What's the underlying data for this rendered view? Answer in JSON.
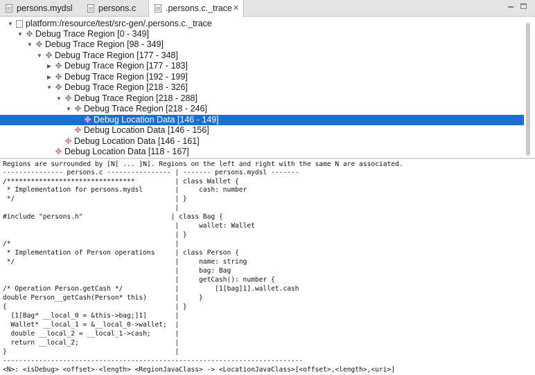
{
  "tabs": [
    {
      "label": "persons.mydsl"
    },
    {
      "label": "persons.c"
    },
    {
      "label": ".persons.c._trace"
    }
  ],
  "window_controls": {
    "minimize": "minimize-icon",
    "maximize": "maximize-icon"
  },
  "tree": {
    "rows": [
      {
        "label": "platform:/resource/test/src-gen/.persons.c._trace",
        "expanded": true,
        "kind": "root"
      },
      {
        "label": "Debug Trace Region [0 - 349]",
        "expanded": true,
        "kind": "region"
      },
      {
        "label": "Debug Trace Region [98 - 349]",
        "expanded": true,
        "kind": "region"
      },
      {
        "label": "Debug Trace Region [177 - 348]",
        "expanded": true,
        "kind": "region"
      },
      {
        "label": "Debug Trace Region [177 - 183]",
        "expanded": false,
        "kind": "region"
      },
      {
        "label": "Debug Trace Region [192 - 199]",
        "expanded": false,
        "kind": "region"
      },
      {
        "label": "Debug Trace Region [218 - 326]",
        "expanded": true,
        "kind": "region"
      },
      {
        "label": "Debug Trace Region [218 - 288]",
        "expanded": true,
        "kind": "region"
      },
      {
        "label": "Debug Trace Region [218 - 246]",
        "expanded": true,
        "kind": "region"
      },
      {
        "label": "Debug Location Data [146 - 149]",
        "kind": "location",
        "selected": true
      },
      {
        "label": "Debug Location Data [146 - 156]",
        "kind": "location"
      },
      {
        "label": "Debug Location Data [146 - 161]",
        "kind": "location"
      },
      {
        "label": "Debug Location Data [118 - 167]",
        "kind": "location"
      }
    ]
  },
  "text_pane": {
    "lines": [
      "Regions are surrounded by [N[ ... ]N]. Regions on the left and right with the same N are associated.",
      "--------------- persons.c ---------------- | ------- persons.mydsl -------",
      "/********************************          | class Wallet {",
      " * Implementation for persons.mydsl        |     cash: number",
      " */                                        | }",
      "                                           |",
      "#include \"persons.h\"                      | class Bag {",
      "                                           |     wallet: Wallet",
      "                                           | }",
      "/*                                         |",
      " * Implementation of Person operations     | class Person {",
      " */                                        |     name: string",
      "                                           |     bag: Bag",
      "                                           |     getCash(): number {",
      "/* Operation Person.getCash */             |         [1[bag]1].wallet.cash",
      "double Person__getCash(Person* this)       |     }",
      "{                                          | }",
      "  [1[Bag* __local_0 = &this->bag;]1]       |",
      "  Wallet* __local_1 = &__local_0->wallet;  |",
      "  double __local_2 = __local_1->cash;      |",
      "  return __local_2;                        |",
      "}                                          |",
      "---------------------------------------------------------------------------",
      "<N>: <isDebug> <offset>-<length> <RegionJavaClass> -> <LocationJavaClass>[<offset>,<length>,<uri>]"
    ]
  }
}
